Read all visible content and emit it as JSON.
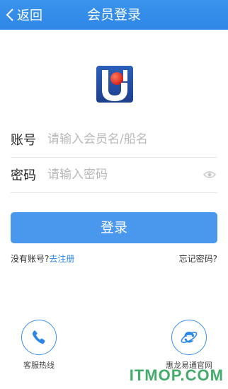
{
  "header": {
    "back_label": "返回",
    "title": "会员登录"
  },
  "form": {
    "account_label": "账号",
    "account_placeholder": "请输入会员名/船名",
    "password_label": "密码",
    "password_placeholder": "请输入密码",
    "login_label": "登录"
  },
  "links": {
    "no_account": "没有账号?",
    "register": "去注册",
    "forgot": "忘记密码?"
  },
  "footer": {
    "hotline_label": "客服热线",
    "site_label": "惠龙易通官网"
  },
  "watermark": "ITMOP.COM",
  "colors": {
    "header": "#2f86e6",
    "button": "#4a98ee",
    "link": "#2f86e6"
  },
  "icons": [
    "back-chevron-icon",
    "app-logo-icon",
    "eye-icon",
    "phone-icon",
    "ie-browser-icon"
  ]
}
